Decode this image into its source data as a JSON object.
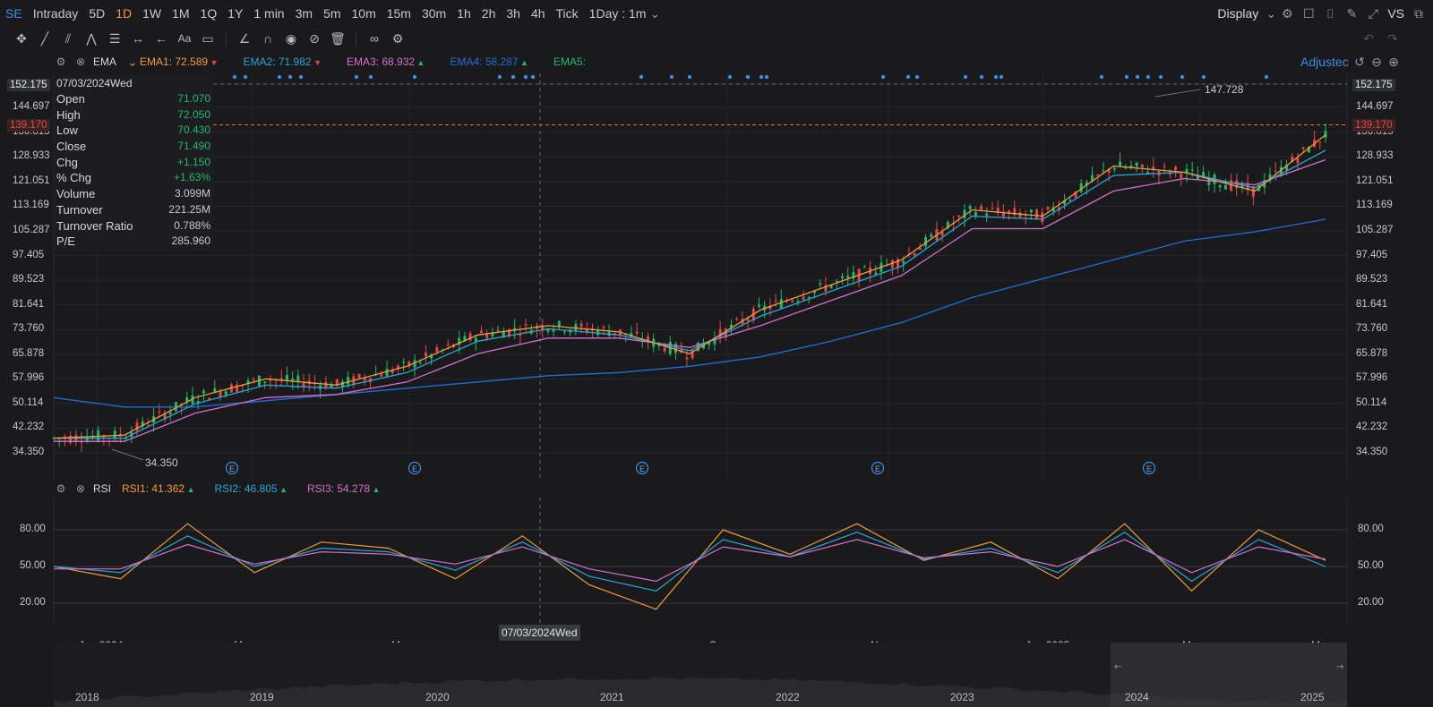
{
  "symbol": "SE",
  "timeframes": [
    {
      "label": "Intraday",
      "active": false
    },
    {
      "label": "5D",
      "active": false
    },
    {
      "label": "1D",
      "active": true
    },
    {
      "label": "1W",
      "active": false
    },
    {
      "label": "1M",
      "active": false
    },
    {
      "label": "1Q",
      "active": false
    },
    {
      "label": "1Y",
      "active": false
    },
    {
      "label": "1 min",
      "active": false
    },
    {
      "label": "3m",
      "active": false
    },
    {
      "label": "5m",
      "active": false
    },
    {
      "label": "10m",
      "active": false
    },
    {
      "label": "15m",
      "active": false
    },
    {
      "label": "30m",
      "active": false
    },
    {
      "label": "1h",
      "active": false
    },
    {
      "label": "2h",
      "active": false
    },
    {
      "label": "3h",
      "active": false
    },
    {
      "label": "4h",
      "active": false
    },
    {
      "label": "Tick",
      "active": false
    }
  ],
  "interval_selector": "1Day : 1m",
  "display_label": "Display",
  "vs_label": "VS",
  "adjusted_label": "Adjustec",
  "colors": {
    "ema1": "#f19a38",
    "ema2": "#28a6d8",
    "ema3": "#d56fd0",
    "ema4": "#1e6fd9",
    "ema5": "#1fb96a",
    "up": "#1fb96a",
    "down": "#e04848",
    "accent": "#3f8de8"
  },
  "ema": {
    "name": "EMA",
    "items": [
      {
        "label": "EMA1:",
        "value": "72.589",
        "dir": "down"
      },
      {
        "label": "EMA2:",
        "value": "71.982",
        "dir": "down"
      },
      {
        "label": "EMA3:",
        "value": "68.932",
        "dir": "up"
      },
      {
        "label": "EMA4:",
        "value": "58.287",
        "dir": "up"
      },
      {
        "label": "EMA5:",
        "value": "",
        "dir": ""
      }
    ]
  },
  "rsi": {
    "name": "RSI",
    "items": [
      {
        "label": "RSI1:",
        "value": "41.362",
        "dir": "up"
      },
      {
        "label": "RSI2:",
        "value": "46.805",
        "dir": "up"
      },
      {
        "label": "RSI3:",
        "value": "54.278",
        "dir": "up"
      }
    ]
  },
  "datapanel": {
    "date": "07/03/2024Wed",
    "rows": [
      {
        "k": "Open",
        "v": "71.070",
        "g": true
      },
      {
        "k": "High",
        "v": "72.050",
        "g": true
      },
      {
        "k": "Low",
        "v": "70.430",
        "g": true
      },
      {
        "k": "Close",
        "v": "71.490",
        "g": true
      },
      {
        "k": "Chg",
        "v": "+1.150",
        "g": true
      },
      {
        "k": "% Chg",
        "v": "+1.63%",
        "g": true
      },
      {
        "k": "Volume",
        "v": "3.099M",
        "g": false
      },
      {
        "k": "Turnover",
        "v": "221.25M",
        "g": false
      },
      {
        "k": "Turnover Ratio",
        "v": "0.788%",
        "g": false
      },
      {
        "k": "P/E",
        "v": "285.960",
        "g": false
      }
    ]
  },
  "y_labels": [
    "152.175",
    "144.697",
    "136.815",
    "128.933",
    "121.051",
    "113.169",
    "105.287",
    "97.405",
    "89.523",
    "81.641",
    "73.760",
    "65.878",
    "57.996",
    "50.114",
    "42.232",
    "34.350"
  ],
  "crosshair_price": "152.175",
  "last_price": "139.170",
  "high_label": "147.728",
  "low_label": "34.350",
  "rsi_labels": [
    "80.00",
    "50.00",
    "20.00"
  ],
  "x_labels": [
    "Jan 2024",
    "Mar",
    "May",
    "Sep",
    "Nov",
    "Jan 2025",
    "Mar",
    "May"
  ],
  "x_cross": "07/03/2024Wed",
  "earnings_marker": "E",
  "nav_years": [
    "2018",
    "2019",
    "2020",
    "2021",
    "2022",
    "2023",
    "2024",
    "2025"
  ],
  "chart_data": {
    "type": "line",
    "title": "",
    "ylim": [
      34.35,
      152.175
    ],
    "x_dates": [
      "Jan 2024",
      "Mar",
      "May",
      "Sep",
      "Nov",
      "Jan 2025",
      "Mar",
      "May"
    ],
    "series": [
      {
        "name": "EMA1",
        "values": [
          39,
          40,
          52,
          58,
          56,
          62,
          72,
          75,
          73,
          66,
          80,
          88,
          96,
          112,
          110,
          126,
          124,
          118,
          136
        ]
      },
      {
        "name": "EMA2",
        "values": [
          39,
          39,
          50,
          56,
          55,
          60,
          70,
          74,
          72,
          67,
          78,
          86,
          94,
          110,
          109,
          123,
          124,
          119,
          131
        ]
      },
      {
        "name": "EMA3",
        "values": [
          38,
          38,
          47,
          52,
          53,
          57,
          66,
          71,
          71,
          68,
          75,
          83,
          91,
          106,
          106,
          118,
          122,
          120,
          128
        ]
      },
      {
        "name": "EMA4",
        "values": [
          52,
          49,
          49,
          51,
          53,
          55,
          57,
          59,
          60,
          62,
          65,
          70,
          76,
          84,
          90,
          96,
          102,
          105,
          109
        ]
      }
    ],
    "rsi_series": [
      {
        "name": "RSI1",
        "values": [
          50,
          40,
          85,
          45,
          70,
          65,
          40,
          75,
          35,
          15,
          80,
          60,
          85,
          55,
          70,
          40,
          85,
          30,
          80,
          55
        ]
      },
      {
        "name": "RSI2",
        "values": [
          50,
          45,
          75,
          50,
          65,
          62,
          47,
          70,
          42,
          30,
          72,
          58,
          78,
          56,
          65,
          45,
          78,
          38,
          72,
          50
        ]
      },
      {
        "name": "RSI3",
        "values": [
          48,
          48,
          68,
          52,
          62,
          60,
          52,
          66,
          48,
          38,
          66,
          58,
          72,
          57,
          62,
          50,
          72,
          45,
          66,
          56
        ]
      }
    ]
  }
}
